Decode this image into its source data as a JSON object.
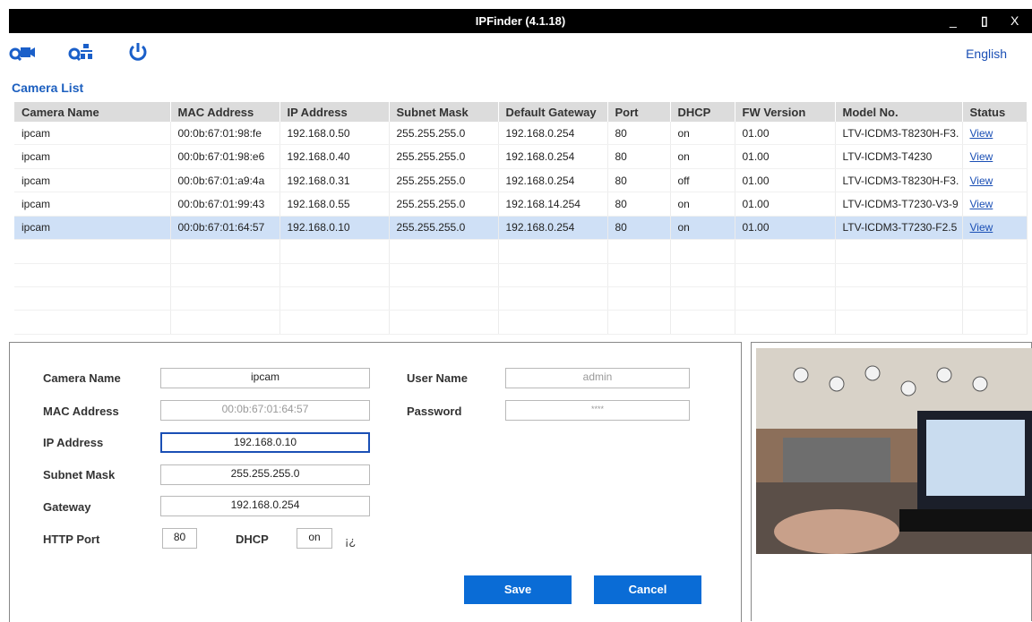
{
  "window": {
    "title": "IPFinder (4.1.18)",
    "minimize": "_",
    "maximize": "▯",
    "close": "X"
  },
  "toolbar": {
    "language": "English"
  },
  "camera_list": {
    "title": "Camera List",
    "columns": [
      "Camera Name",
      "MAC Address",
      "IP Address",
      "Subnet Mask",
      "Default Gateway",
      "Port",
      "DHCP",
      "FW Version",
      "Model No.",
      "Status"
    ],
    "rows": [
      [
        "ipcam",
        "00:0b:67:01:98:fe",
        "192.168.0.50",
        "255.255.255.0",
        "192.168.0.254",
        "80",
        "on",
        "01.00",
        "LTV-ICDM3-T8230H-F3.",
        "View"
      ],
      [
        "ipcam",
        "00:0b:67:01:98:e6",
        "192.168.0.40",
        "255.255.255.0",
        "192.168.0.254",
        "80",
        "on",
        "01.00",
        "LTV-ICDM3-T4230",
        "View"
      ],
      [
        "ipcam",
        "00:0b:67:01:a9:4a",
        "192.168.0.31",
        "255.255.255.0",
        "192.168.0.254",
        "80",
        "off",
        "01.00",
        "LTV-ICDM3-T8230H-F3.",
        "View"
      ],
      [
        "ipcam",
        "00:0b:67:01:99:43",
        "192.168.0.55",
        "255.255.255.0",
        "192.168.14.254",
        "80",
        "on",
        "01.00",
        "LTV-ICDM3-T7230-V3-9",
        "View"
      ],
      [
        "ipcam",
        "00:0b:67:01:64:57",
        "192.168.0.10",
        "255.255.255.0",
        "192.168.0.254",
        "80",
        "on",
        "01.00",
        "LTV-ICDM3-T7230-F2.5",
        "View"
      ]
    ],
    "selected_row": 4
  },
  "form": {
    "camera_name_label": "Camera Name",
    "camera_name": "ipcam",
    "mac_label": "MAC Address",
    "mac": "00:0b:67:01:64:57",
    "ip_label": "IP Address",
    "ip": "192.168.0.10",
    "subnet_label": "Subnet Mask",
    "subnet": "255.255.255.0",
    "gateway_label": "Gateway",
    "gateway": "192.168.0.254",
    "http_port_label": "HTTP Port",
    "http_port": "80",
    "dhcp_label": "DHCP",
    "dhcp": "on",
    "dhcp_glyph": "¡¿",
    "user_label": "User Name",
    "user": "admin",
    "password_label": "Password",
    "password": "****",
    "save": "Save",
    "cancel": "Cancel"
  },
  "colors": {
    "accent": "#0a6cd6",
    "selection": "#cfe0f6",
    "title_blue": "#1c5fbf"
  }
}
